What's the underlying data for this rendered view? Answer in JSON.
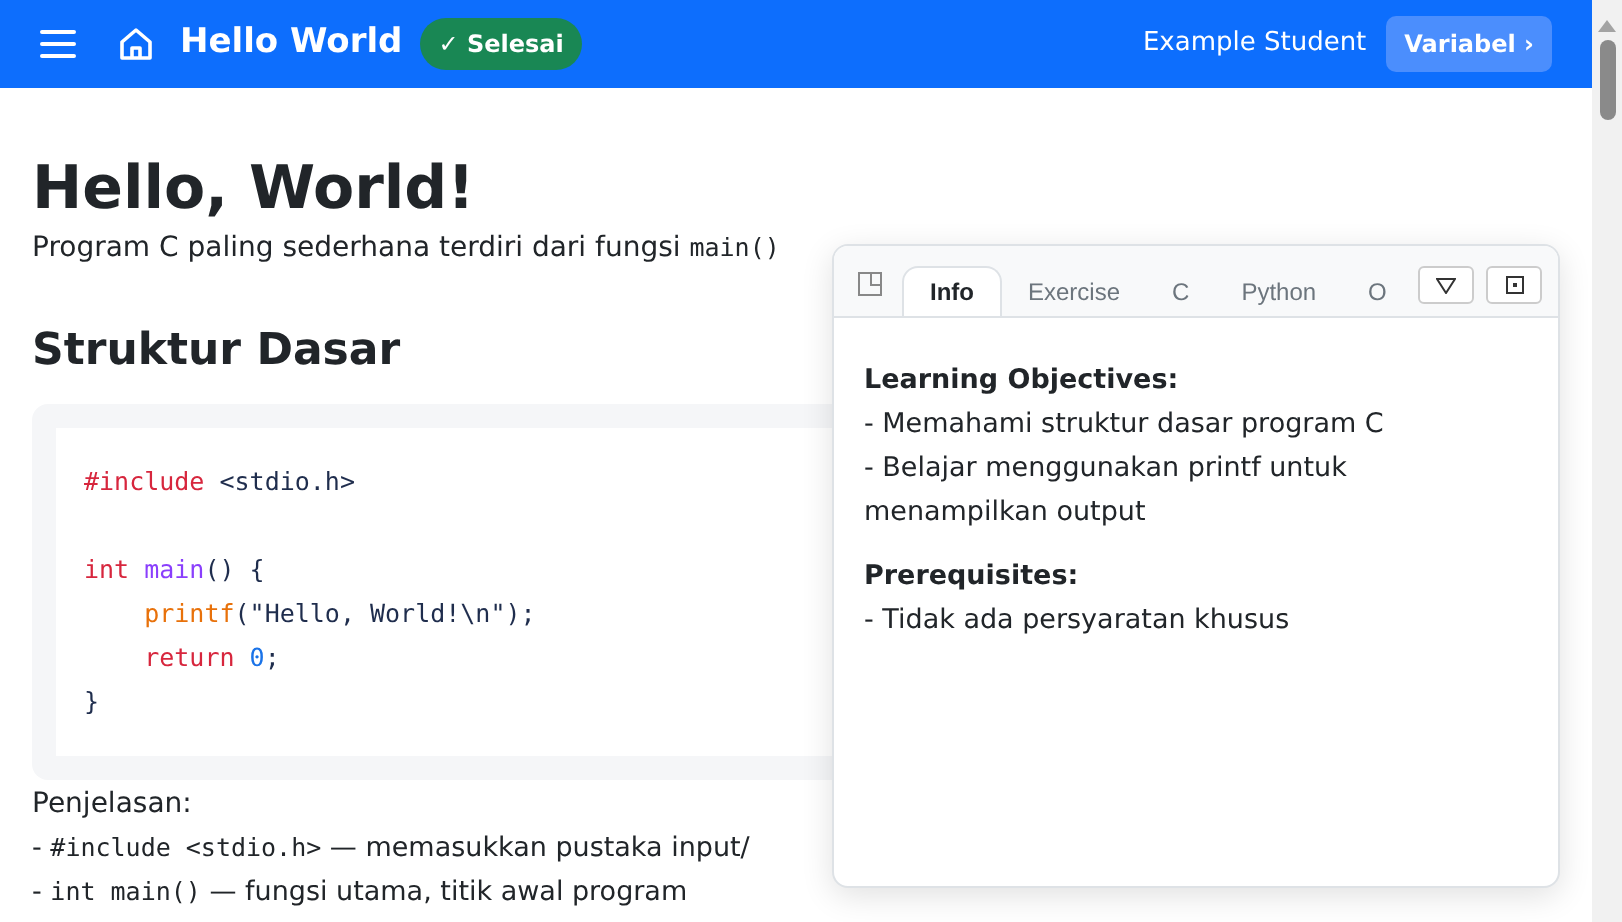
{
  "header": {
    "title": "Hello World",
    "badge": "✓ Selesai",
    "user": "Example Student",
    "next_button": "Variabel ›"
  },
  "content": {
    "title": "Hello, World!",
    "intro": [
      {
        "kind": "text",
        "text": "Program C paling sederhana terdiri dari fungsi "
      },
      {
        "kind": "code",
        "text": "main()"
      }
    ],
    "section_title": "Struktur Dasar",
    "code_lines": [
      {
        "kind": "line",
        "tokens": [
          {
            "kind": "directive",
            "text": "#include"
          },
          {
            "kind": "plain",
            "text": " <stdio.h>"
          }
        ]
      },
      {
        "kind": "blank"
      },
      {
        "kind": "line",
        "tokens": [
          {
            "kind": "keyword",
            "text": "int "
          },
          {
            "kind": "function",
            "text": "main"
          },
          {
            "kind": "plain",
            "text": "() {"
          }
        ]
      },
      {
        "kind": "line",
        "tokens": [
          {
            "kind": "builtin",
            "text": "    printf"
          },
          {
            "kind": "plain",
            "text": "(\"Hello, World!\\n\");"
          }
        ]
      },
      {
        "kind": "line",
        "tokens": [
          {
            "kind": "keyword",
            "text": "    return "
          },
          {
            "kind": "number",
            "text": "0"
          },
          {
            "kind": "plain",
            "text": ";"
          }
        ]
      },
      {
        "kind": "line",
        "tokens": [
          {
            "kind": "plain",
            "text": "}"
          }
        ]
      }
    ],
    "explanation_label": "Penjelasan:",
    "explanations": [
      [
        {
          "kind": "text",
          "text": "- "
        },
        {
          "kind": "code",
          "text": "#include <stdio.h>"
        },
        {
          "kind": "text",
          "text": " — memasukkan pustaka input/"
        }
      ],
      [
        {
          "kind": "text",
          "text": "- "
        },
        {
          "kind": "code",
          "text": "int main()"
        },
        {
          "kind": "text",
          "text": " — fungsi utama, titik awal program"
        }
      ]
    ]
  },
  "panel": {
    "tabs": [
      {
        "label": "Info",
        "selected": true
      },
      {
        "label": "Exercise",
        "selected": false
      },
      {
        "label": "C",
        "selected": false
      },
      {
        "label": "Python",
        "selected": false
      },
      {
        "label": "O",
        "selected": false
      }
    ],
    "sections": [
      {
        "heading": "Learning Objectives:",
        "items": [
          "- Memahami struktur dasar program C",
          "- Belajar menggunakan printf untuk menampilkan output"
        ]
      },
      {
        "heading": "Prerequisites:",
        "items": [
          "- Tidak ada persyaratan khusus"
        ]
      }
    ]
  }
}
